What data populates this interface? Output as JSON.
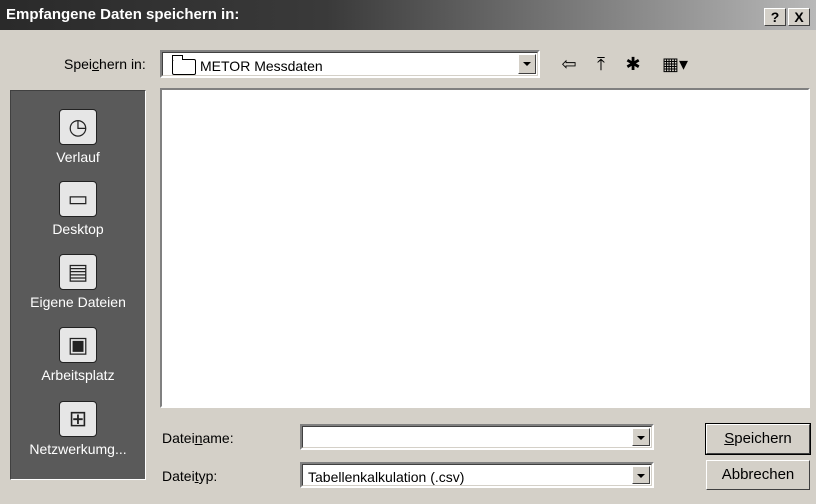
{
  "window": {
    "title": "Empfangene Daten speichern in:",
    "help_label": "?",
    "close_label": "X"
  },
  "save_in": {
    "label_prefix": "Spei",
    "label_mnemonic": "c",
    "label_suffix": "hern in:",
    "value": "METOR Messdaten"
  },
  "toolbar": {
    "back_icon": "⇦",
    "up_icon": "⤒",
    "new_folder_icon": "✱",
    "views_icon": "▦▾"
  },
  "places": [
    {
      "label": "Verlauf",
      "icon": "history-icon"
    },
    {
      "label": "Desktop",
      "icon": "desktop-icon"
    },
    {
      "label": "Eigene Dateien",
      "icon": "my-documents-icon"
    },
    {
      "label": "Arbeitsplatz",
      "icon": "my-computer-icon"
    },
    {
      "label": "Netzwerkumg...",
      "icon": "network-icon"
    }
  ],
  "filename": {
    "label_prefix": "Datei",
    "label_mnemonic": "n",
    "label_suffix": "ame:",
    "value": ""
  },
  "filetype": {
    "label_prefix": "Datei",
    "label_mnemonic": "t",
    "label_suffix": "yp:",
    "value": "Tabellenkalkulation (.csv)"
  },
  "buttons": {
    "save_mnemonic": "S",
    "save_rest": "peichern",
    "cancel": "Abbrechen"
  }
}
